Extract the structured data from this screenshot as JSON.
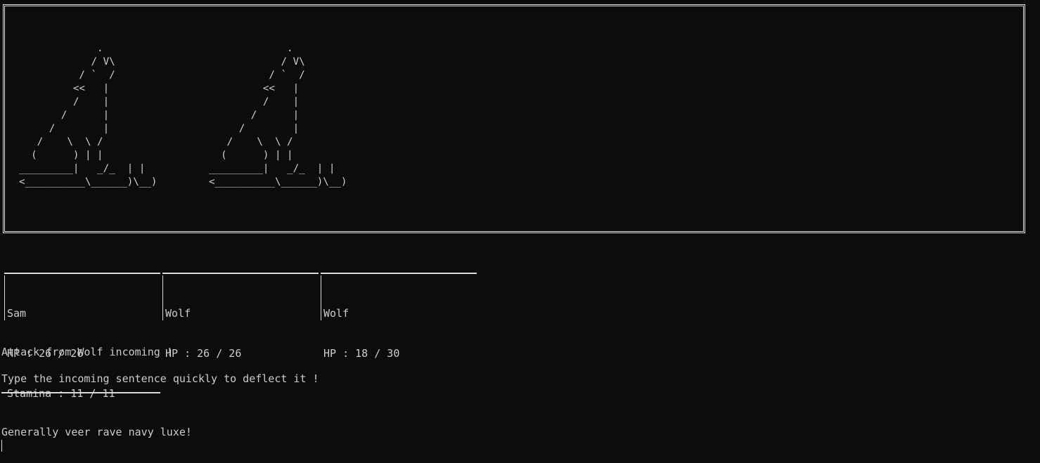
{
  "battle_art": {
    "wolf_1": "             .\n            / V\\\n          / `  /\n         <<   |\n         /    |\n       /      |\n     /        |\n   /    \\  \\ /\n  (      ) | |\n_________|   _/_  | |\n<__________\\______)\\__)",
    "wolf_2": "             .\n            / V\\\n          / `  /\n         <<   |\n         /    |\n       /      |\n     /        |\n   /    \\  \\ /\n  (      ) | |\n_________|   _/_  | |\n<__________\\______)\\__)"
  },
  "combatants": [
    {
      "name": "Sam",
      "hp": "HP : 26 / 26",
      "stamina": "Stamina : 11 / 11"
    },
    {
      "name": "Wolf",
      "hp": "HP : 26 / 26",
      "stamina": ""
    },
    {
      "name": "Wolf",
      "hp": "HP : 18 / 30",
      "stamina": ""
    }
  ],
  "messages": {
    "attack": "Attack from Wolf incoming !",
    "instruction": "Type the incoming sentence quickly to deflect it !",
    "sentence": "Generally veer rave navy luxe!"
  },
  "colors": {
    "background": "#0c0c0c",
    "text": "#cccccc",
    "border": "#e0e0e0"
  }
}
